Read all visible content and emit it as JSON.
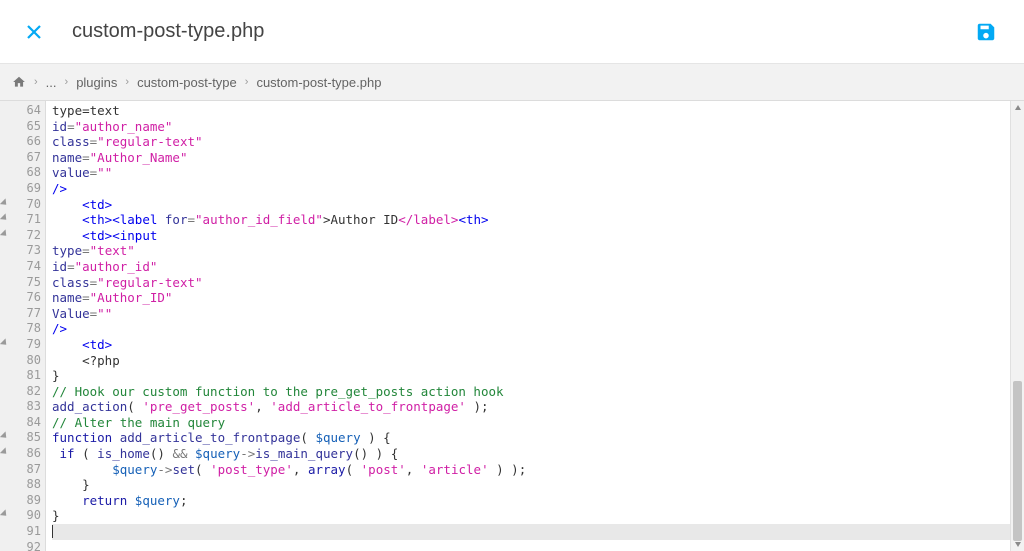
{
  "header": {
    "title": "custom-post-type.php"
  },
  "breadcrumb": {
    "ellipsis": "...",
    "items": [
      "plugins",
      "custom-post-type",
      "custom-post-type.php"
    ]
  },
  "editor": {
    "first_line": 64,
    "last_line": 92,
    "active_line": 91,
    "fold_lines": [
      70,
      71,
      72,
      79,
      85,
      86,
      90
    ],
    "code": {
      "64": {
        "plain": "type=text"
      },
      "65": {
        "tokens": [
          [
            "id",
            "attr"
          ],
          [
            "=",
            "op"
          ],
          [
            "\"author_name\"",
            "str"
          ]
        ]
      },
      "66": {
        "tokens": [
          [
            "class",
            "attr"
          ],
          [
            "=",
            "op"
          ],
          [
            "\"regular-text\"",
            "str"
          ]
        ]
      },
      "67": {
        "tokens": [
          [
            "name",
            "attr"
          ],
          [
            "=",
            "op"
          ],
          [
            "\"Author_Name\"",
            "str"
          ]
        ]
      },
      "68": {
        "tokens": [
          [
            "value",
            "attr"
          ],
          [
            "=",
            "op"
          ],
          [
            "\"\"",
            "str"
          ]
        ]
      },
      "69": {
        "tokens": [
          [
            "/>",
            "tag"
          ]
        ]
      },
      "70": {
        "indent": "    ",
        "tokens": [
          [
            "<td>",
            "tag"
          ]
        ]
      },
      "71": {
        "indent": "    ",
        "tokens": [
          [
            "<th>",
            "tag"
          ],
          [
            "<label",
            "tag"
          ],
          [
            " ",
            ""
          ],
          [
            "for",
            "attr"
          ],
          [
            "=",
            "op"
          ],
          [
            "\"author_id_field\"",
            "str"
          ],
          [
            ">",
            ""
          ],
          [
            "Author ID",
            ""
          ],
          [
            "</label>",
            "tagend"
          ],
          [
            "<th>",
            "tag"
          ]
        ]
      },
      "72": {
        "indent": "    ",
        "tokens": [
          [
            "<td>",
            "tag"
          ],
          [
            "<input",
            "tag"
          ]
        ]
      },
      "73": {
        "tokens": [
          [
            "type",
            "attr"
          ],
          [
            "=",
            "op"
          ],
          [
            "\"text\"",
            "str"
          ]
        ]
      },
      "74": {
        "tokens": [
          [
            "id",
            "attr"
          ],
          [
            "=",
            "op"
          ],
          [
            "\"author_id\"",
            "str"
          ]
        ]
      },
      "75": {
        "tokens": [
          [
            "class",
            "attr"
          ],
          [
            "=",
            "op"
          ],
          [
            "\"regular-text\"",
            "str"
          ]
        ]
      },
      "76": {
        "tokens": [
          [
            "name",
            "attr"
          ],
          [
            "=",
            "op"
          ],
          [
            "\"Author_ID\"",
            "str"
          ]
        ]
      },
      "77": {
        "tokens": [
          [
            "Value",
            "attr"
          ],
          [
            "=",
            "op"
          ],
          [
            "\"\"",
            "str"
          ]
        ]
      },
      "78": {
        "tokens": [
          [
            "/>",
            "tag"
          ]
        ]
      },
      "79": {
        "indent": "    ",
        "tokens": [
          [
            "<td>",
            "tag"
          ]
        ]
      },
      "80": {
        "indent": "    ",
        "plain": "<?php"
      },
      "81": {
        "plain": "}"
      },
      "82": {
        "comment": "// Hook our custom function to the pre_get_posts action hook"
      },
      "83": {
        "tokens": [
          [
            "add_action",
            "fn"
          ],
          [
            "( ",
            ""
          ],
          [
            "'pre_get_posts'",
            "str"
          ],
          [
            ", ",
            ""
          ],
          [
            "'add_article_to_frontpage'",
            "str"
          ],
          [
            " );",
            ""
          ]
        ]
      },
      "84": {
        "comment": "// Alter the main query"
      },
      "85": {
        "tokens": [
          [
            "function",
            "key"
          ],
          [
            " ",
            ""
          ],
          [
            "add_article_to_frontpage",
            "fn"
          ],
          [
            "( ",
            ""
          ],
          [
            "$query",
            "var2"
          ],
          [
            " ) {",
            ""
          ]
        ]
      },
      "86": {
        "tokens": [
          [
            " ",
            ""
          ],
          [
            "if",
            "key"
          ],
          [
            " ( ",
            ""
          ],
          [
            "is_home",
            "fn"
          ],
          [
            "() ",
            ""
          ],
          [
            "&&",
            "op"
          ],
          [
            " ",
            ""
          ],
          [
            "$query",
            "var2"
          ],
          [
            "->",
            "op"
          ],
          [
            "is_main_query",
            "fn"
          ],
          [
            "() ) {",
            ""
          ]
        ]
      },
      "87": {
        "indent": "        ",
        "tokens": [
          [
            "$query",
            "var2"
          ],
          [
            "->",
            "op"
          ],
          [
            "set",
            "fn"
          ],
          [
            "( ",
            ""
          ],
          [
            "'post_type'",
            "str"
          ],
          [
            ", ",
            ""
          ],
          [
            "array",
            "key"
          ],
          [
            "( ",
            ""
          ],
          [
            "'post'",
            "str"
          ],
          [
            ", ",
            ""
          ],
          [
            "'article'",
            "str"
          ],
          [
            " ) );",
            ""
          ]
        ]
      },
      "88": {
        "indent": "    ",
        "plain": "}"
      },
      "89": {
        "indent": "    ",
        "tokens": [
          [
            "return",
            "return"
          ],
          [
            " ",
            ""
          ],
          [
            "$query",
            "var2"
          ],
          [
            ";",
            ""
          ]
        ]
      },
      "90": {
        "plain": "}"
      },
      "91": {
        "plain": ""
      },
      "92": {
        "plain": ""
      }
    }
  }
}
